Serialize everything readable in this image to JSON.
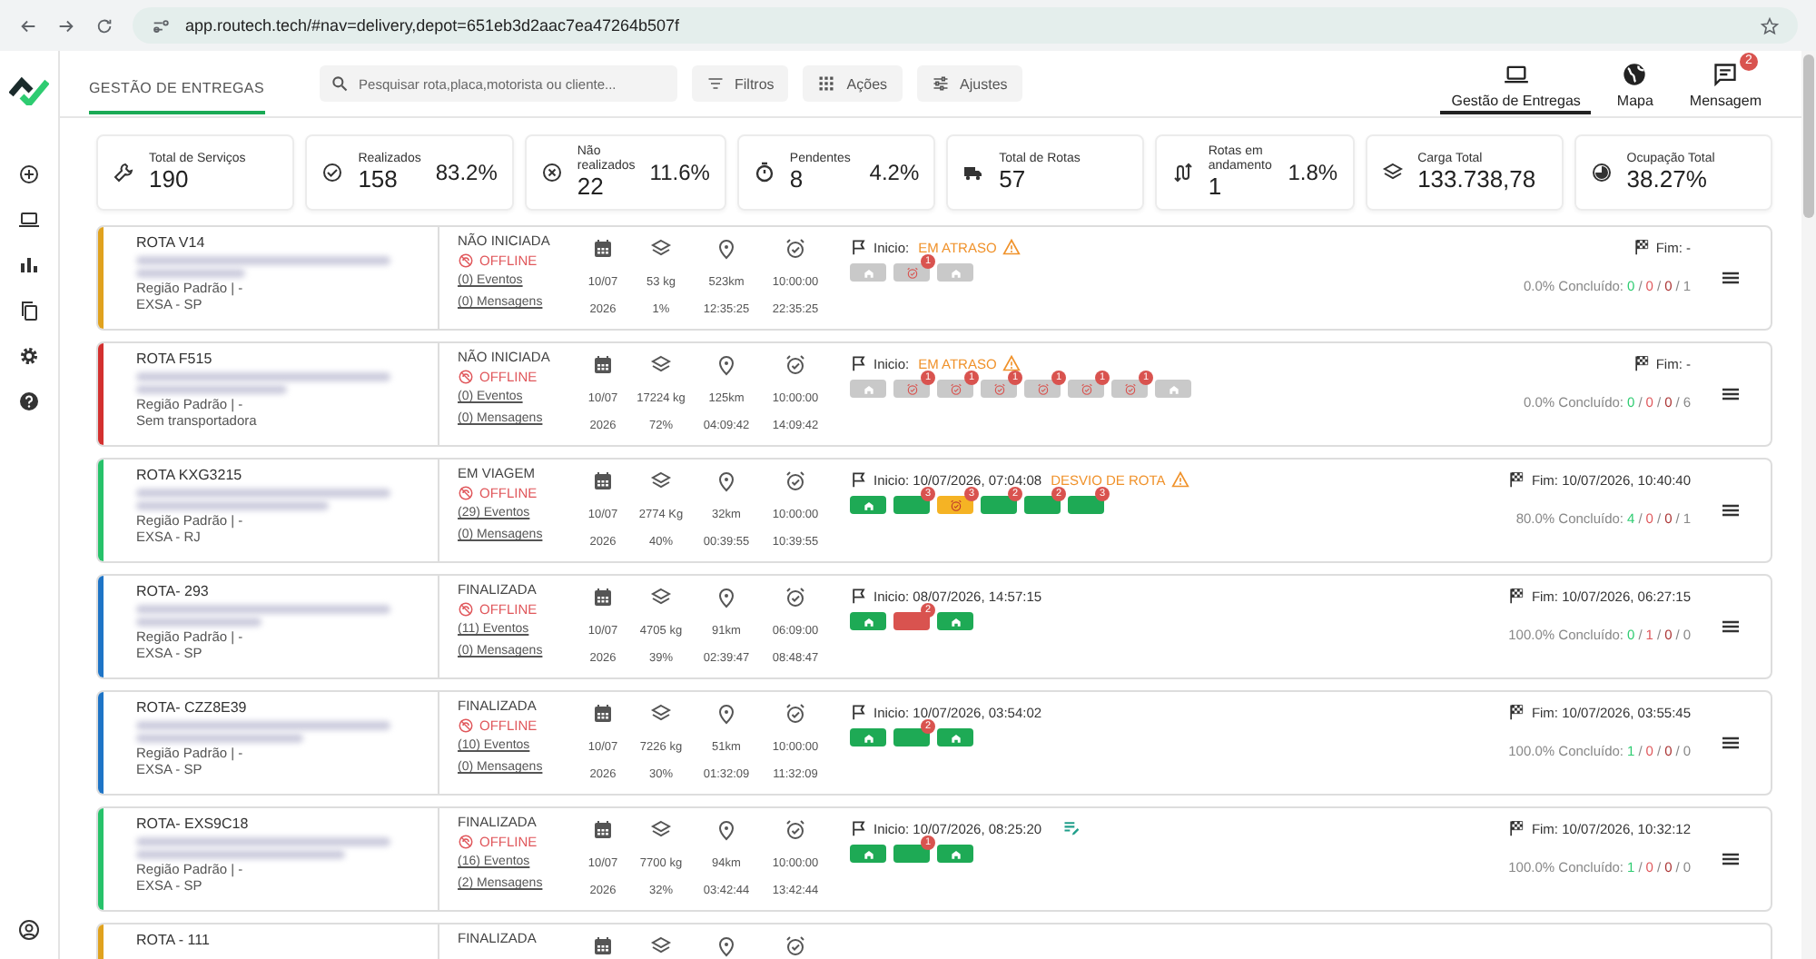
{
  "browser": {
    "url": "app.routech.tech/#nav=delivery,depot=651eb3d2aac7ea47264b507f"
  },
  "header": {
    "page_tab": "GESTÃO DE ENTREGAS",
    "search": {
      "placeholder": "Pesquisar rota,placa,motorista ou cliente..."
    },
    "buttons": [
      "Filtros",
      "Ações",
      "Ajustes"
    ],
    "nav": [
      {
        "label": "Gestão de Entregas",
        "selected": true
      },
      {
        "label": "Mapa",
        "selected": false
      },
      {
        "label": "Mensagem",
        "selected": false,
        "badge": "2"
      }
    ]
  },
  "stats": [
    {
      "label": "Total de Serviços",
      "value": "190"
    },
    {
      "label": "Realizados",
      "value": "158",
      "percent": "83.2%"
    },
    {
      "label": "Não realizados",
      "value": "22",
      "percent": "11.6%"
    },
    {
      "label": "Pendentes",
      "value": "8",
      "percent": "4.2%"
    },
    {
      "label": "Total de Rotas",
      "value": "57"
    },
    {
      "label": "Rotas em andamento",
      "value": "1",
      "percent": "1.8%"
    },
    {
      "label": "Carga Total",
      "value": "133.738,78"
    },
    {
      "label": "Ocupação Total",
      "value": "38.27%"
    }
  ],
  "routes": [
    {
      "name": "ROTA V14",
      "color": "#e0a21e",
      "region": "Região Padrão | -",
      "carrier": "EXSA - SP",
      "status": "NÃO INICIADA",
      "connection": "OFFLINE",
      "events": "(0) Eventos",
      "messages": "(0) Mensagens",
      "date": "10/07",
      "year": "2026",
      "weight": "53 kg",
      "occupancy": "1%",
      "distance": "523km",
      "duration": "12:35:25",
      "start_time": "10:00:00",
      "end_time": "22:35:25",
      "start": "Inicio:",
      "alert": "EM ATRASO",
      "note": false,
      "stops": [
        {
          "color": "#c9c9c9",
          "kind": "depot"
        },
        {
          "color": "#c9c9c9",
          "kind": "late",
          "badge": "1"
        },
        {
          "color": "#c9c9c9",
          "kind": "depot"
        }
      ],
      "end": "Fim: -",
      "progress": "0.0% Concluído:",
      "counts": [
        "0",
        "/",
        "0",
        "/",
        "0",
        "/",
        "1"
      ]
    },
    {
      "name": "ROTA F515",
      "color": "#d3302f",
      "region": "Região Padrão | -",
      "carrier": "Sem transportadora",
      "status": "NÃO INICIADA",
      "connection": "OFFLINE",
      "events": "(0) Eventos",
      "messages": "(0) Mensagens",
      "date": "10/07",
      "year": "2026",
      "weight": "17224 kg",
      "occupancy": "72%",
      "distance": "125km",
      "duration": "04:09:42",
      "start_time": "10:00:00",
      "end_time": "14:09:42",
      "start": "Inicio:",
      "alert": "EM ATRASO",
      "note": false,
      "stops": [
        {
          "color": "#c9c9c9",
          "kind": "depot"
        },
        {
          "color": "#c9c9c9",
          "kind": "late",
          "badge": "1"
        },
        {
          "color": "#c9c9c9",
          "kind": "late",
          "badge": "1"
        },
        {
          "color": "#c9c9c9",
          "kind": "late",
          "badge": "1"
        },
        {
          "color": "#c9c9c9",
          "kind": "late",
          "badge": "1"
        },
        {
          "color": "#c9c9c9",
          "kind": "late",
          "badge": "1"
        },
        {
          "color": "#c9c9c9",
          "kind": "late",
          "badge": "1"
        },
        {
          "color": "#c9c9c9",
          "kind": "depot"
        }
      ],
      "end": "Fim: -",
      "progress": "0.0% Concluído:",
      "counts": [
        "0",
        "/",
        "0",
        "/",
        "0",
        "/",
        "6"
      ]
    },
    {
      "name": "ROTA KXG3215",
      "color": "#27c26a",
      "region": "Região Padrão | -",
      "carrier": "EXSA - RJ",
      "status": "EM VIAGEM",
      "connection": "OFFLINE",
      "events": "(29) Eventos",
      "messages": "(0) Mensagens",
      "date": "10/07",
      "year": "2026",
      "weight": "2774 Kg",
      "occupancy": "40%",
      "distance": "32km",
      "duration": "00:39:55",
      "start_time": "10:00:00",
      "end_time": "10:39:55",
      "start": "Inicio: 10/07/2026, 07:04:08",
      "alert": "DESVIO DE ROTA",
      "note": false,
      "stops": [
        {
          "color": "#1eaa55",
          "kind": "depot"
        },
        {
          "color": "#1eaa55",
          "kind": "stop",
          "badge": "3"
        },
        {
          "color": "#f5b324",
          "kind": "late",
          "badge": "3"
        },
        {
          "color": "#1eaa55",
          "kind": "stop",
          "badge": "2"
        },
        {
          "color": "#1eaa55",
          "kind": "stop",
          "badge": "2"
        },
        {
          "color": "#1eaa55",
          "kind": "stop",
          "badge": "3"
        }
      ],
      "end": "Fim: 10/07/2026, 10:40:40",
      "progress": "80.0% Concluído:",
      "counts": [
        "4",
        "/",
        "0",
        "/",
        "0",
        "/",
        "1"
      ]
    },
    {
      "name": "ROTA- 293",
      "color": "#1e74c6",
      "region": "Região Padrão | -",
      "carrier": "EXSA - SP",
      "status": "FINALIZADA",
      "connection": "OFFLINE",
      "events": "(11) Eventos",
      "messages": "(0) Mensagens",
      "date": "10/07",
      "year": "2026",
      "weight": "4705 kg",
      "occupancy": "39%",
      "distance": "91km",
      "duration": "02:39:47",
      "start_time": "06:09:00",
      "end_time": "08:48:47",
      "start": "Inicio: 08/07/2026, 14:57:15",
      "note": false,
      "stops": [
        {
          "color": "#1eaa55",
          "kind": "depot"
        },
        {
          "color": "#d9534f",
          "kind": "stop",
          "badge": "2"
        },
        {
          "color": "#1eaa55",
          "kind": "depot"
        }
      ],
      "end": "Fim: 10/07/2026, 06:27:15",
      "progress": "100.0% Concluído:",
      "counts": [
        "0",
        "/",
        "1",
        "/",
        "0",
        "/",
        "0"
      ]
    },
    {
      "name": "ROTA- CZZ8E39",
      "color": "#1e74c6",
      "region": "Região Padrão | -",
      "carrier": "EXSA - SP",
      "status": "FINALIZADA",
      "connection": "OFFLINE",
      "events": "(10) Eventos",
      "messages": "(0) Mensagens",
      "date": "10/07",
      "year": "2026",
      "weight": "7226 kg",
      "occupancy": "30%",
      "distance": "51km",
      "duration": "01:32:09",
      "start_time": "10:00:00",
      "end_time": "11:32:09",
      "start": "Inicio: 10/07/2026, 03:54:02",
      "note": false,
      "stops": [
        {
          "color": "#1eaa55",
          "kind": "depot"
        },
        {
          "color": "#1eaa55",
          "kind": "stop",
          "badge": "2"
        },
        {
          "color": "#1eaa55",
          "kind": "depot"
        }
      ],
      "end": "Fim: 10/07/2026, 03:55:45",
      "progress": "100.0% Concluído:",
      "counts": [
        "1",
        "/",
        "0",
        "/",
        "0",
        "/",
        "0"
      ]
    },
    {
      "name": "ROTA- EXS9C18",
      "color": "#27c26a",
      "region": "Região Padrão | -",
      "carrier": "EXSA - SP",
      "status": "FINALIZADA",
      "connection": "OFFLINE",
      "events": "(16) Eventos",
      "messages": "(2) Mensagens",
      "date": "10/07",
      "year": "2026",
      "weight": "7700 kg",
      "occupancy": "32%",
      "distance": "94km",
      "duration": "03:42:44",
      "start_time": "10:00:00",
      "end_time": "13:42:44",
      "start": "Inicio: 10/07/2026, 08:25:20",
      "note": true,
      "stops": [
        {
          "color": "#1eaa55",
          "kind": "depot"
        },
        {
          "color": "#1eaa55",
          "kind": "stop",
          "badge": "1"
        },
        {
          "color": "#1eaa55",
          "kind": "depot"
        }
      ],
      "end": "Fim: 10/07/2026, 10:32:12",
      "progress": "100.0% Concluído:",
      "counts": [
        "1",
        "/",
        "0",
        "/",
        "0",
        "/",
        "0"
      ]
    },
    {
      "name": "ROTA - 111",
      "color": "#e0a21e",
      "status": "FINALIZADA"
    }
  ]
}
